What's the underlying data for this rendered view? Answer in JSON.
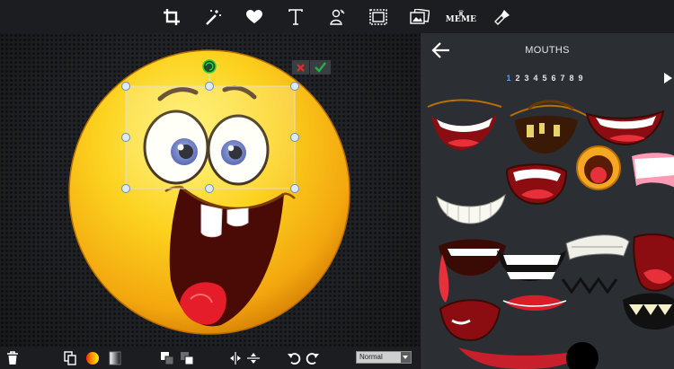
{
  "toolbar": {
    "tools": [
      {
        "name": "crop-tool",
        "icon": "crop-icon"
      },
      {
        "name": "magic-wand-tool",
        "icon": "magic-wand-icon"
      },
      {
        "name": "favorites-tool",
        "icon": "heart-icon"
      },
      {
        "name": "text-tool",
        "icon": "text-icon"
      },
      {
        "name": "clipart-tool",
        "icon": "clipart-icon"
      },
      {
        "name": "frame-tool",
        "icon": "frame-icon"
      },
      {
        "name": "photo-tool",
        "icon": "photos-icon"
      },
      {
        "name": "meme-tool",
        "icon": "meme-icon",
        "label": "MEME"
      },
      {
        "name": "paint-tool",
        "icon": "paint-brush-icon"
      }
    ]
  },
  "panel": {
    "title": "MOUTHS",
    "pages": [
      "1",
      "2",
      "3",
      "4",
      "5",
      "6",
      "7",
      "8",
      "9"
    ],
    "active_page": "1"
  },
  "bottombar": {
    "blend_mode": "Normal"
  },
  "colors": {
    "toolbar_bg": "#1b1d20",
    "panel_bg": "#2b2e33",
    "accent": "#4aa3ff",
    "cancel": "#e03030",
    "confirm": "#22b14c",
    "emoji_yellow": "#f7c21b"
  }
}
